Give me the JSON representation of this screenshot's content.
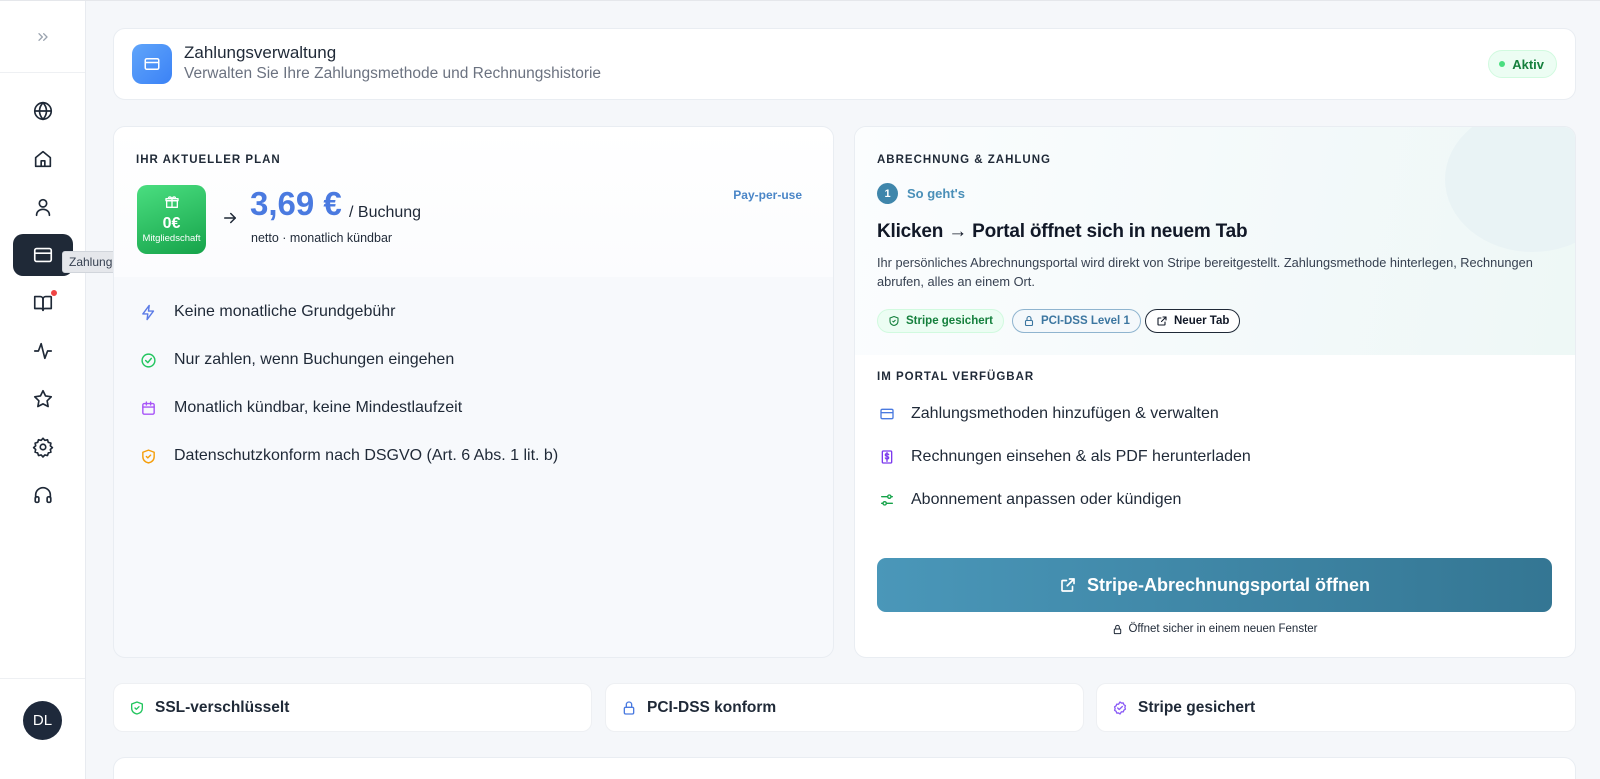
{
  "sidebar": {
    "expand_icon": "chevrons-right-icon",
    "items": [
      {
        "name": "globe",
        "icon": "globe-icon"
      },
      {
        "name": "home",
        "icon": "home-icon"
      },
      {
        "name": "profile",
        "icon": "user-icon"
      },
      {
        "name": "payment",
        "icon": "credit-card-icon",
        "active": true
      },
      {
        "name": "book",
        "icon": "book-open-icon",
        "badge": true
      },
      {
        "name": "activity",
        "icon": "activity-icon"
      },
      {
        "name": "favorites",
        "icon": "star-icon"
      },
      {
        "name": "settings",
        "icon": "gear-icon"
      },
      {
        "name": "support",
        "icon": "headphones-icon"
      }
    ],
    "tooltip": "Zahlung",
    "avatar_initials": "DL"
  },
  "header": {
    "title": "Zahlungsverwaltung",
    "subtitle": "Verwalten Sie Ihre Zahlungsmethode und Rechnungshistorie",
    "status": "Aktiv"
  },
  "plan": {
    "section_label": "IHR AKTUELLER PLAN",
    "tier_price": "0€",
    "tier_label": "Mitgliedschaft",
    "price": "3,69 €",
    "price_unit": "/ Buchung",
    "price_note": "netto · monatlich kündbar",
    "model": "Pay-per-use",
    "features": [
      {
        "text": "Keine monatliche Grundgebühr",
        "icon": "zap-icon",
        "color": "#5b7be6"
      },
      {
        "text": "Nur zahlen, wenn Buchungen eingehen",
        "icon": "check-circle-icon",
        "color": "#22c55e"
      },
      {
        "text": "Monatlich kündbar, keine Mindestlaufzeit",
        "icon": "calendar-icon",
        "color": "#a855f7"
      },
      {
        "text": "Datenschutzkonform nach DSGVO (Art. 6 Abs. 1 lit. b)",
        "icon": "shield-check-icon",
        "color": "#f59e0b"
      }
    ]
  },
  "billing": {
    "section_label": "ABRECHNUNG & ZAHLUNG",
    "step_number": "1",
    "step_label": "So geht's",
    "heading": "Klicken → Portal öffnet sich in neuem Tab",
    "description": "Ihr persönliches Abrechnungsportal wird direkt von Stripe bereitgestellt. Zahlungsmethode hinterlegen, Rechnungen abrufen, alles an einem Ort.",
    "chips": [
      "Stripe gesichert",
      "PCI-DSS Level 1",
      "Neuer Tab"
    ],
    "portal_label": "IM PORTAL VERFÜGBAR",
    "portal_items": [
      {
        "text": "Zahlungsmethoden hinzufügen & verwalten",
        "icon": "credit-card-icon",
        "color": "#4a7ae0"
      },
      {
        "text": "Rechnungen einsehen & als PDF herunterladen",
        "icon": "invoice-icon",
        "color": "#7c3aed"
      },
      {
        "text": "Abonnement anpassen oder kündigen",
        "icon": "sliders-icon",
        "color": "#16a34a"
      }
    ],
    "button_label": "Stripe-Abrechnungsportal öffnen",
    "note": "Öffnet sicher in einem neuen Fenster"
  },
  "trust_badges": [
    {
      "text": "SSL-verschlüsselt",
      "icon": "shield-check-icon",
      "color": "#22c55e"
    },
    {
      "text": "PCI-DSS konform",
      "icon": "lock-icon",
      "color": "#4a7ae0"
    },
    {
      "text": "Stripe gesichert",
      "icon": "check-badge-icon",
      "color": "#8b5cf6"
    }
  ]
}
